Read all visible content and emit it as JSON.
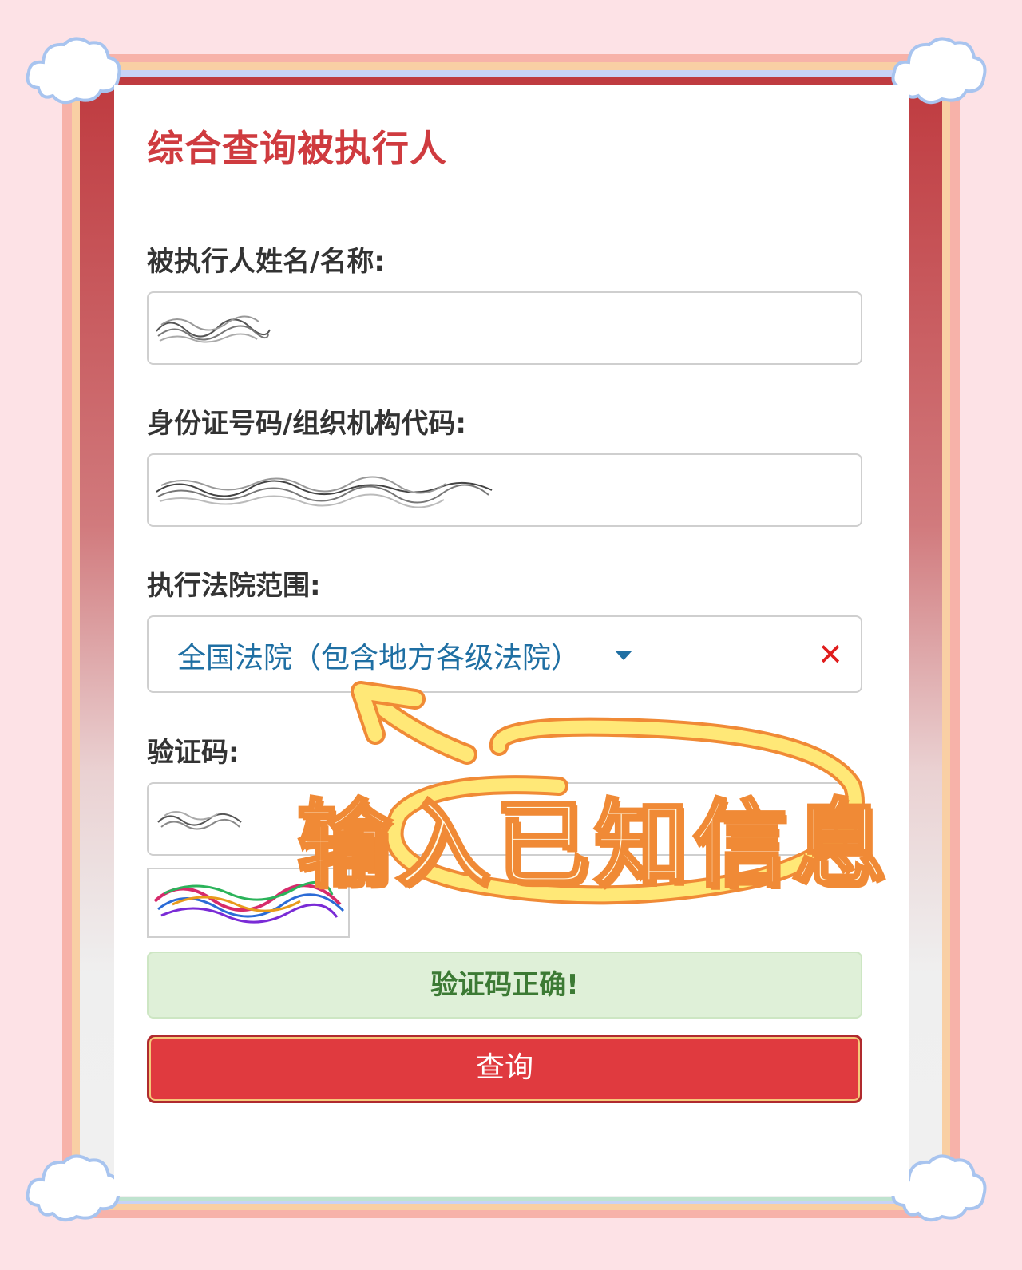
{
  "page": {
    "title": "综合查询被执行人"
  },
  "form": {
    "name_label": "被执行人姓名/名称:",
    "id_label": "身份证号码/组织机构代码:",
    "court_label": "执行法院范围:",
    "court_selected": "全国法院（包含地方各级法院）",
    "captcha_label": "验证码:",
    "captcha_status": "验证码正确!",
    "query_button": "查询"
  },
  "annotation": {
    "text": "输入已知信息"
  },
  "colors": {
    "title": "#cf3b3f",
    "select_text": "#1f6fa3",
    "success_bg": "#dff0d8",
    "success_text": "#3c7a34",
    "button_bg": "#e03a3f",
    "annotation_fill": "#fff3b0",
    "annotation_stroke": "#f08a36"
  }
}
